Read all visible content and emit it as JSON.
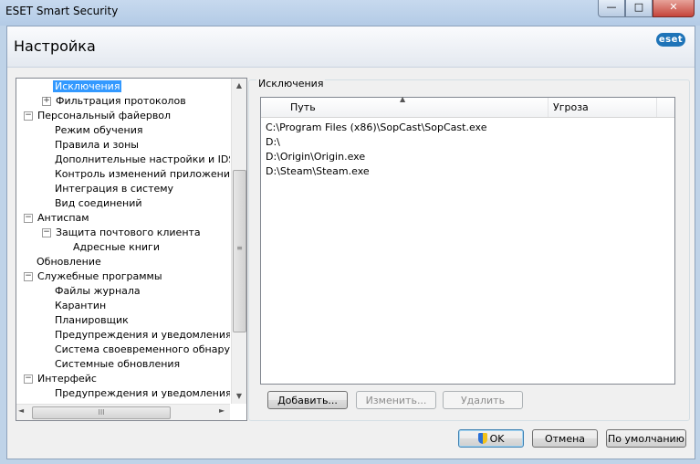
{
  "window": {
    "title": "ESET Smart Security",
    "controls": {
      "minimize": "—",
      "maximize": "□",
      "close": "✕"
    }
  },
  "header": {
    "title": "Настройка",
    "logo_text": "eset"
  },
  "tree": {
    "items": [
      {
        "label": "Исключения",
        "level": 2,
        "expander": "",
        "selected": true
      },
      {
        "label": "Фильтрация протоколов",
        "level": 2,
        "expander": "+"
      },
      {
        "label": "Персональный файервол",
        "level": 1,
        "expander": "−"
      },
      {
        "label": "Режим обучения",
        "level": 2,
        "expander": ""
      },
      {
        "label": "Правила и зоны",
        "level": 2,
        "expander": ""
      },
      {
        "label": "Дополнительные настройки и IDS",
        "level": 2,
        "expander": ""
      },
      {
        "label": "Контроль изменений приложений",
        "level": 2,
        "expander": ""
      },
      {
        "label": "Интеграция в систему",
        "level": 2,
        "expander": ""
      },
      {
        "label": "Вид соединений",
        "level": 2,
        "expander": ""
      },
      {
        "label": "Антиспам",
        "level": 1,
        "expander": "−"
      },
      {
        "label": "Защита почтового клиента",
        "level": 2,
        "expander": "−"
      },
      {
        "label": "Адресные книги",
        "level": 3,
        "expander": ""
      },
      {
        "label": "Обновление",
        "level": 1,
        "expander": ""
      },
      {
        "label": "Служебные программы",
        "level": 1,
        "expander": "−"
      },
      {
        "label": "Файлы журнала",
        "level": 2,
        "expander": ""
      },
      {
        "label": "Карантин",
        "level": 2,
        "expander": ""
      },
      {
        "label": "Планировщик",
        "level": 2,
        "expander": ""
      },
      {
        "label": "Предупреждения и уведомления",
        "level": 2,
        "expander": ""
      },
      {
        "label": "Система своевременного обнаружен",
        "level": 2,
        "expander": ""
      },
      {
        "label": "Системные обновления",
        "level": 2,
        "expander": ""
      },
      {
        "label": "Интерфейс",
        "level": 1,
        "expander": "−"
      },
      {
        "label": "Предупреждения и уведомления",
        "level": 2,
        "expander": ""
      }
    ],
    "scroll_up": "▲",
    "scroll_down": "▼",
    "scroll_grip": "≡",
    "hscroll_left": "◄",
    "hscroll_right": "►",
    "hscroll_grip": "III"
  },
  "exclusions": {
    "group_label": "Исключения",
    "columns": {
      "path": "Путь",
      "threat": "Угроза"
    },
    "sort_indicator": "▲",
    "rows": [
      "C:\\Program Files (x86)\\SopCast\\SopCast.exe",
      "D:\\",
      "D:\\Origin\\Origin.exe",
      "D:\\Steam\\Steam.exe"
    ],
    "buttons": {
      "add": "Добавить...",
      "edit": "Изменить...",
      "delete": "Удалить"
    }
  },
  "footer": {
    "ok": "OK",
    "cancel": "Отмена",
    "default": "По умолчанию"
  },
  "colors": {
    "selection": "#3399ff",
    "logo": "#1f74b8"
  }
}
